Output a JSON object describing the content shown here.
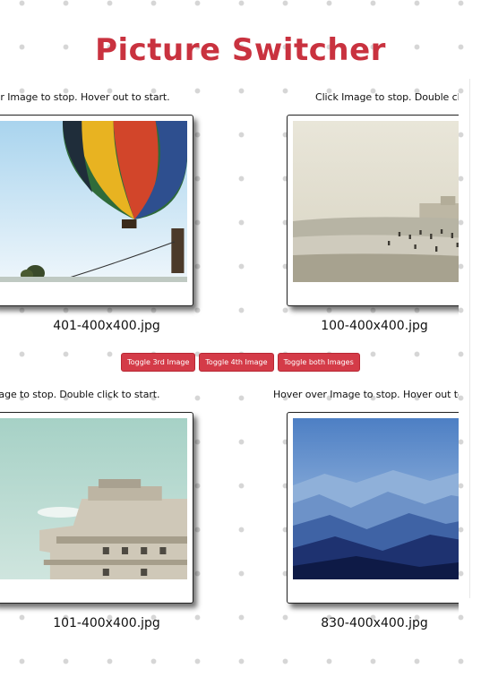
{
  "page": {
    "title": "Picture Switcher",
    "accent_color": "#c9323f",
    "button_color": "#d43b48"
  },
  "panels": [
    {
      "instruction": "Hover over Image to stop. Hover out to start.",
      "filename": "401-400x400.jpg",
      "image": "hot-air-balloon-photo"
    },
    {
      "instruction": "Click Image to stop. Double click to start.",
      "filename": "100-400x400.jpg",
      "image": "beach-crowd-photo"
    },
    {
      "instruction": "Click Image to stop. Double click to start.",
      "filename": "101-400x400.jpg",
      "image": "concrete-building-photo"
    },
    {
      "instruction": "Hover over Image to stop. Hover out to start.",
      "filename": "830-400x400.jpg",
      "image": "blue-mountains-photo"
    }
  ],
  "buttons": {
    "toggle_3rd": "Toggle 3rd Image",
    "toggle_4th": "Toggle 4th Image",
    "toggle_both": "Toggle both Images"
  }
}
